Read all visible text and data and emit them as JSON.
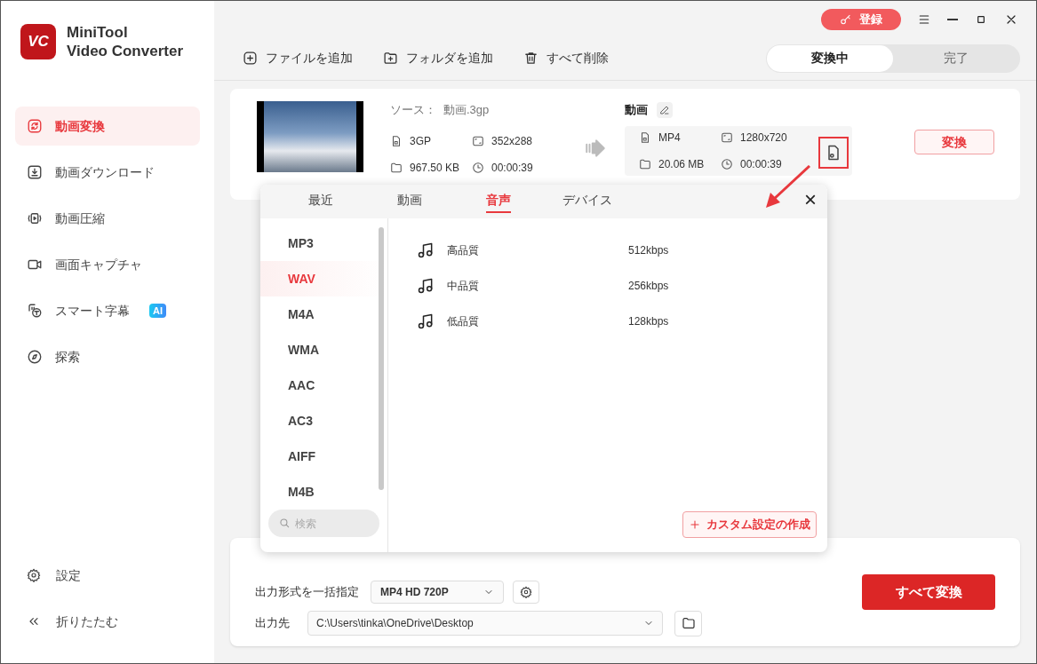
{
  "app": {
    "name_line1": "MiniTool",
    "name_line2": "Video Converter",
    "logo_text": "VC"
  },
  "sidebar": {
    "items": [
      {
        "label": "動画変換",
        "selected": true
      },
      {
        "label": "動画ダウンロード",
        "selected": false
      },
      {
        "label": "動画圧縮",
        "selected": false
      },
      {
        "label": "画面キャプチャ",
        "selected": false
      },
      {
        "label": "スマート字幕",
        "selected": false,
        "badge": "AI"
      },
      {
        "label": "探索",
        "selected": false
      }
    ],
    "bottom": [
      {
        "label": "設定"
      },
      {
        "label": "折りたたむ"
      }
    ]
  },
  "titlebar": {
    "register_button": "登録"
  },
  "toolbar": {
    "buttons": [
      {
        "label": "ファイルを追加"
      },
      {
        "label": "フォルダを追加"
      },
      {
        "label": "すべて削除"
      }
    ],
    "tabs": [
      {
        "label": "変換中",
        "selected": true
      },
      {
        "label": "完了",
        "selected": false
      }
    ]
  },
  "file": {
    "source_label": "ソース：",
    "source_name": "動画.3gp",
    "source": {
      "format": "3GP",
      "resolution": "352x288",
      "size": "967.50 KB",
      "duration": "00:00:39"
    },
    "target_label": "動画",
    "target": {
      "format": "MP4",
      "resolution": "1280x720",
      "size": "20.06 MB",
      "duration": "00:00:39"
    },
    "convert_button": "変換"
  },
  "format_popup": {
    "tabs": [
      {
        "label": "最近",
        "selected": false
      },
      {
        "label": "動画",
        "selected": false
      },
      {
        "label": "音声",
        "selected": true
      },
      {
        "label": "デバイス",
        "selected": false
      }
    ],
    "close": "×",
    "formats": [
      {
        "label": "MP3",
        "selected": false
      },
      {
        "label": "WAV",
        "selected": true
      },
      {
        "label": "M4A",
        "selected": false
      },
      {
        "label": "WMA",
        "selected": false
      },
      {
        "label": "AAC",
        "selected": false
      },
      {
        "label": "AC3",
        "selected": false
      },
      {
        "label": "AIFF",
        "selected": false
      },
      {
        "label": "M4B",
        "selected": false
      }
    ],
    "search_placeholder": "検索",
    "presets": [
      {
        "quality": "高品質",
        "bitrate": "512kbps"
      },
      {
        "quality": "中品質",
        "bitrate": "256kbps"
      },
      {
        "quality": "低品質",
        "bitrate": "128kbps"
      }
    ],
    "custom_button": "カスタム設定の作成"
  },
  "bottom_panel": {
    "format_label": "出力形式を一括指定",
    "format_value": "MP4 HD 720P",
    "output_label": "出力先",
    "output_path": "C:\\Users\\tinka\\OneDrive\\Desktop",
    "convert_all": "すべて変換"
  }
}
